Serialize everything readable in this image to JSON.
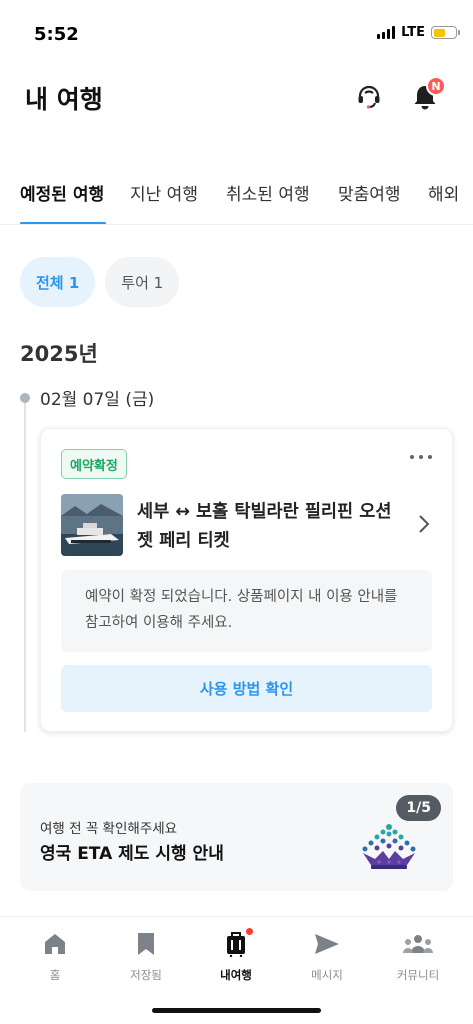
{
  "status_bar": {
    "time": "5:52",
    "network": "LTE"
  },
  "header": {
    "title": "내 여행",
    "notification_badge": "N"
  },
  "tabs": [
    {
      "label": "예정된 여행",
      "active": true
    },
    {
      "label": "지난 여행",
      "active": false
    },
    {
      "label": "취소된 여행",
      "active": false
    },
    {
      "label": "맞춤여행",
      "active": false
    },
    {
      "label": "해외",
      "active": false
    }
  ],
  "filters": [
    {
      "label": "전체 1",
      "active": true
    },
    {
      "label": "투어 1",
      "active": false
    }
  ],
  "year": "2025년",
  "trip": {
    "date": "02월 07일 (금)",
    "status": "예약확정",
    "title": "세부 ↔ 보홀 탁빌라란 필리핀 오션젯 페리 티켓",
    "notice": "예약이 확정 되었습니다. 상품페이지 내 이용 안내를 참고하여 이용해 주세요.",
    "guide_button": "사용 방법 확인"
  },
  "promo": {
    "subtitle": "여행 전 꼭 확인해주세요",
    "title": "영국 ETA 제도 시행 안내",
    "counter": "1/5"
  },
  "bottom_nav": [
    {
      "label": "홈",
      "icon": "home-icon",
      "active": false
    },
    {
      "label": "저장됨",
      "icon": "bookmark-icon",
      "active": false
    },
    {
      "label": "내여행",
      "icon": "luggage-icon",
      "active": true
    },
    {
      "label": "메시지",
      "icon": "send-icon",
      "active": false
    },
    {
      "label": "커뮤니티",
      "icon": "community-icon",
      "active": false
    }
  ],
  "colors": {
    "accent": "#2b96ed",
    "confirmed_green": "#1aa862",
    "badge_red": "#ff5a5a"
  }
}
